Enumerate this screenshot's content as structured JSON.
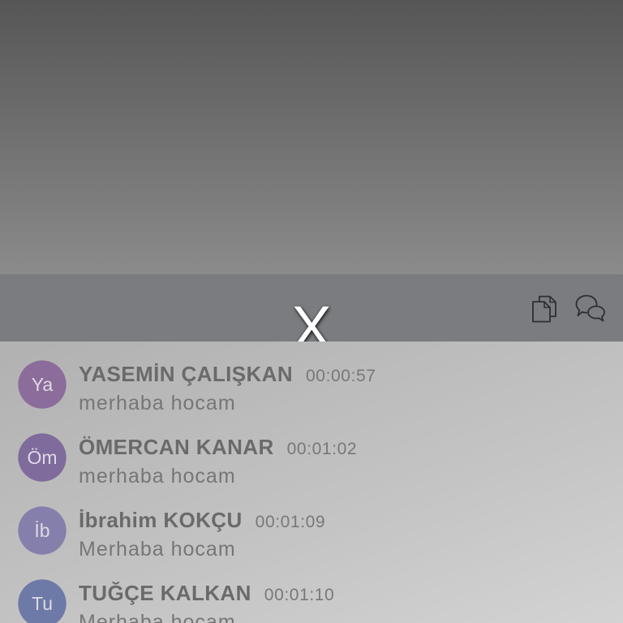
{
  "header": {
    "close_label": "X",
    "icons": [
      "documents-icon",
      "chat-bubbles-icon"
    ]
  },
  "messages": [
    {
      "avatar_initials": "Ya",
      "avatar_color": "#8c6c9b",
      "name": "YASEMİN ÇALIŞKAN",
      "time": "00:00:57",
      "text": "merhaba hocam"
    },
    {
      "avatar_initials": "Öm",
      "avatar_color": "#7f6b9c",
      "name": "ÖMERCAN KANAR",
      "time": "00:01:02",
      "text": "merhaba hocam"
    },
    {
      "avatar_initials": "İb",
      "avatar_color": "#857fab",
      "name": "İbrahim KOKÇU",
      "time": "00:01:09",
      "text": "Merhaba hocam"
    },
    {
      "avatar_initials": "Tu",
      "avatar_color": "#6d79a6",
      "name": "TUĞÇE KALKAN",
      "time": "00:01:10",
      "text": "Merhaba hocam"
    }
  ]
}
